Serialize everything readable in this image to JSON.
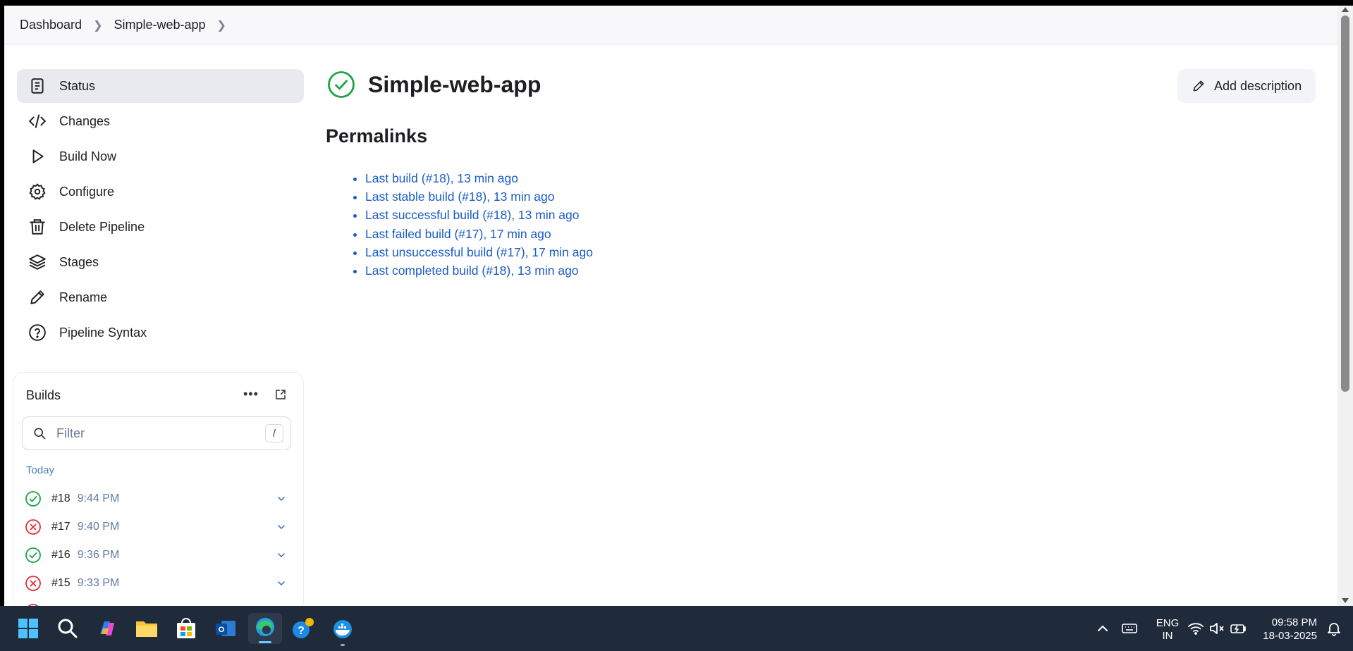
{
  "breadcrumb": {
    "items": [
      "Dashboard",
      "Simple-web-app"
    ]
  },
  "sidebar": {
    "items": [
      {
        "label": "Status",
        "icon": "clipboard-icon"
      },
      {
        "label": "Changes",
        "icon": "code-icon"
      },
      {
        "label": "Build Now",
        "icon": "play-icon"
      },
      {
        "label": "Configure",
        "icon": "gear-icon"
      },
      {
        "label": "Delete Pipeline",
        "icon": "trash-icon"
      },
      {
        "label": "Stages",
        "icon": "layers-icon"
      },
      {
        "label": "Rename",
        "icon": "pencil-icon"
      },
      {
        "label": "Pipeline Syntax",
        "icon": "help-circle-icon"
      }
    ]
  },
  "builds": {
    "title": "Builds",
    "filter_placeholder": "Filter",
    "filter_shortcut": "/",
    "group_label": "Today",
    "rows": [
      {
        "number": "#18",
        "time": "9:44 PM",
        "status": "success"
      },
      {
        "number": "#17",
        "time": "9:40 PM",
        "status": "failed"
      },
      {
        "number": "#16",
        "time": "9:36 PM",
        "status": "success"
      },
      {
        "number": "#15",
        "time": "9:33 PM",
        "status": "failed"
      }
    ]
  },
  "main": {
    "title": "Simple-web-app",
    "add_description_label": "Add description",
    "permalinks_title": "Permalinks",
    "permalinks": [
      "Last build (#18), 13 min ago",
      "Last stable build (#18), 13 min ago",
      "Last successful build (#18), 13 min ago",
      "Last failed build (#17), 17 min ago",
      "Last unsuccessful build (#17), 17 min ago",
      "Last completed build (#18), 13 min ago"
    ]
  },
  "taskbar": {
    "lang_line1": "ENG",
    "lang_line2": "IN",
    "time": "09:58 PM",
    "date": "18-03-2025"
  },
  "colors": {
    "success": "#1ea446",
    "failed": "#e0303a",
    "link": "#1a5bc8",
    "taskbar": "#1f2a3a"
  }
}
